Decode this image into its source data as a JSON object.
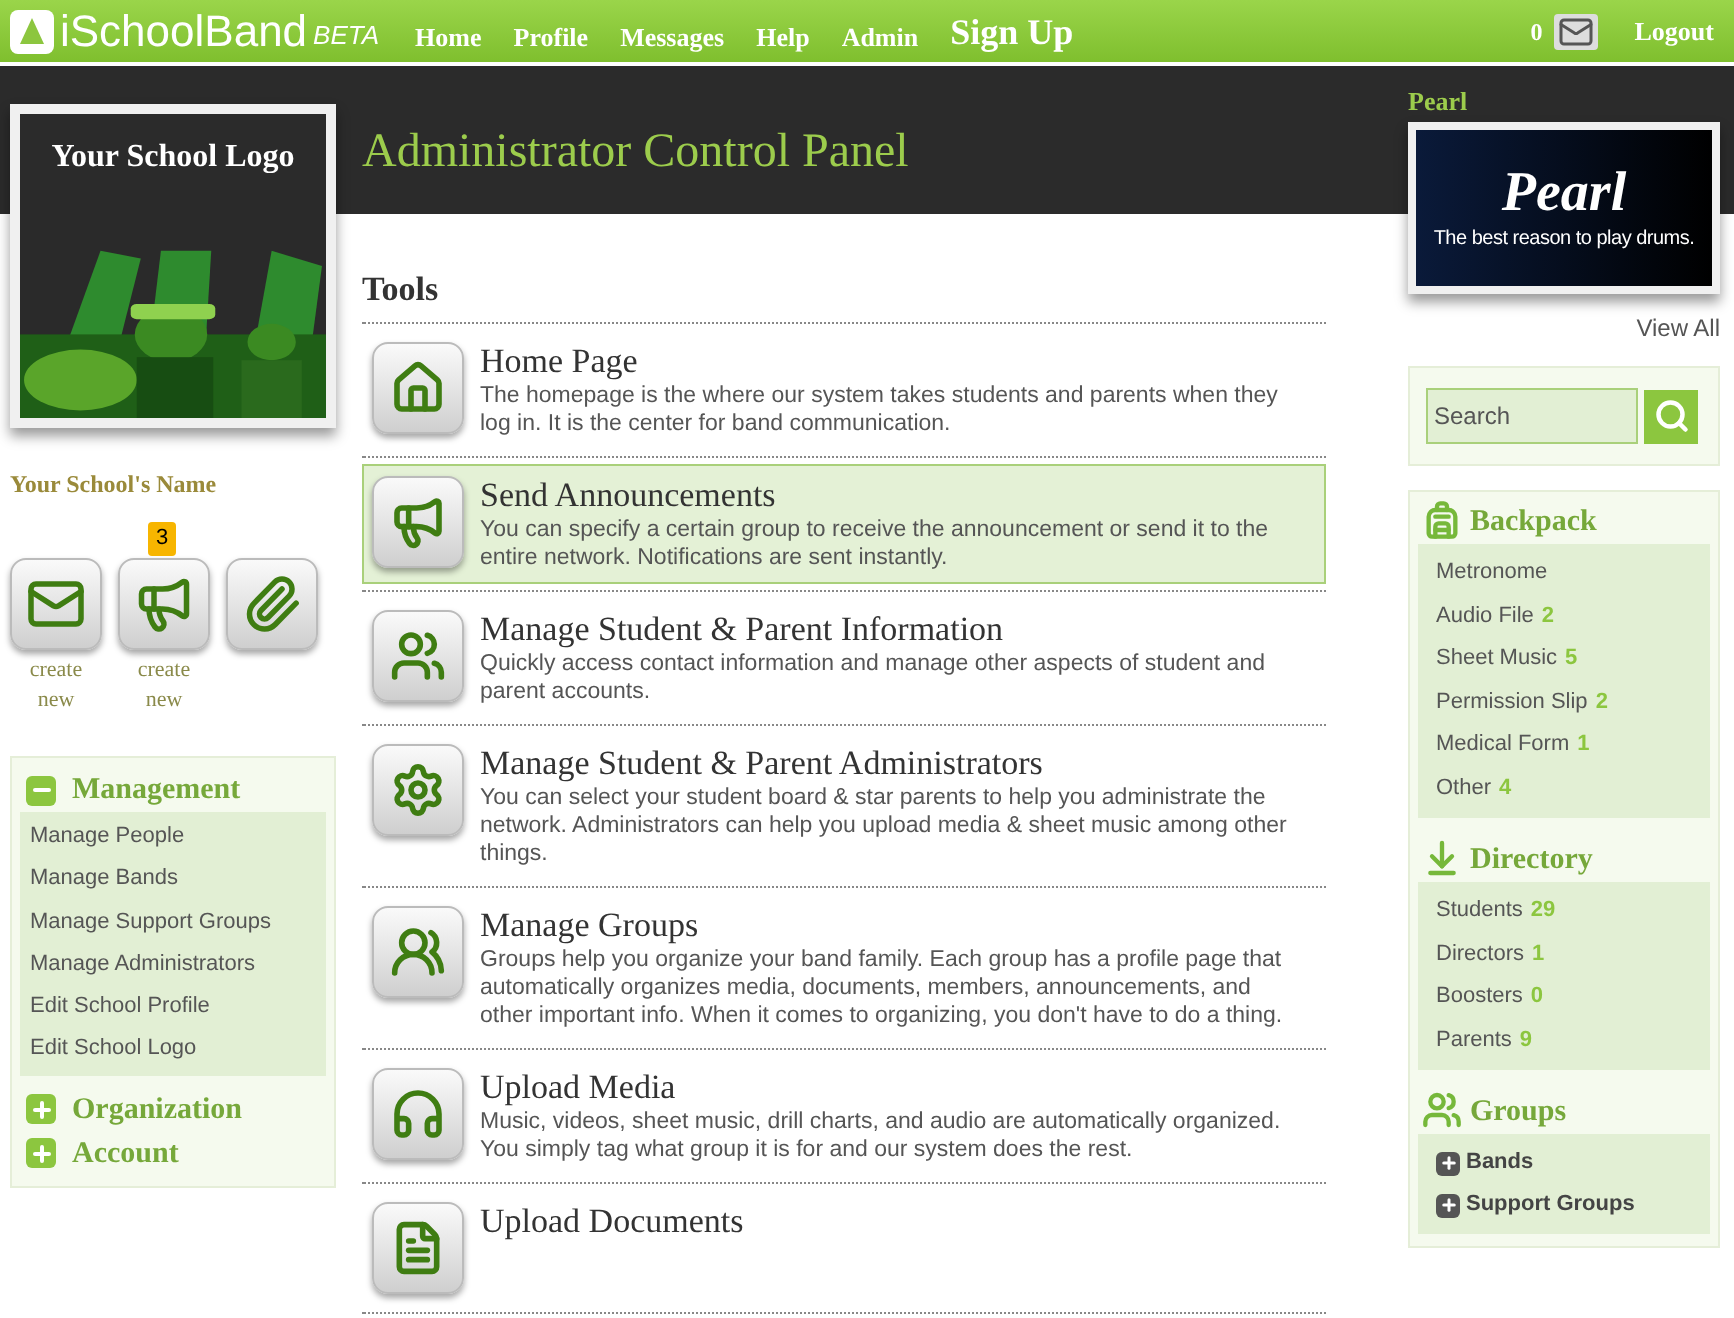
{
  "header": {
    "brand": "iSchoolBand",
    "beta": "BETA",
    "nav": [
      {
        "label": "Home",
        "kind": "link"
      },
      {
        "label": "Profile",
        "kind": "link"
      },
      {
        "label": "Messages",
        "kind": "link"
      },
      {
        "label": "Help",
        "kind": "link"
      },
      {
        "label": "Admin",
        "kind": "link"
      },
      {
        "label": "Sign Up",
        "kind": "signup"
      }
    ],
    "message_count": "0",
    "logout": "Logout"
  },
  "left": {
    "logo_text": "Your School Logo",
    "school_name": "Your School's Name",
    "quick_actions": [
      {
        "kind": "message",
        "caption": "create new"
      },
      {
        "kind": "announcement",
        "caption": "create new",
        "badge": "3"
      },
      {
        "kind": "attachment"
      }
    ],
    "sections": [
      {
        "title": "Management",
        "expanded": true,
        "items": [
          "Manage People",
          "Manage Bands",
          "Manage Support Groups",
          "Manage Administrators",
          "Edit School Profile",
          "Edit School Logo"
        ]
      },
      {
        "title": "Organization",
        "expanded": false
      },
      {
        "title": "Account",
        "expanded": false
      }
    ]
  },
  "main": {
    "title": "Administrator Control Panel",
    "section": "Tools",
    "tools": [
      {
        "title": "Home Page",
        "description": "The homepage is the where our system takes students and parents when they log in. It is the center for band communication.",
        "selected": false
      },
      {
        "title": "Send Announcements",
        "description": "You can specify a certain group to receive the announcement or send it to the entire network. Notifications are sent instantly.",
        "selected": true
      },
      {
        "title": "Manage Student & Parent Information",
        "description": "Quickly access contact information and manage other aspects of student and parent accounts.",
        "selected": false
      },
      {
        "title": "Manage Student & Parent Administrators",
        "description": "You can select your student board & star parents to help you administrate the network. Administrators can help you upload media & sheet music among other things.",
        "selected": false
      },
      {
        "title": "Manage Groups",
        "description": "Groups help you organize your band family. Each group has a profile page that automatically organizes media, documents, members, announcements, and other important info. When it comes to organizing, you don't have to do a thing.",
        "selected": false
      },
      {
        "title": "Upload Media",
        "description": "Music, videos, sheet music, drill charts, and audio are automatically organized. You simply tag what group it is for and our system does the rest.",
        "selected": false
      },
      {
        "title": "Upload Documents",
        "selected": false
      }
    ]
  },
  "right": {
    "sponsor": "Pearl",
    "ad": {
      "logo": "Pearl",
      "tagline": "The best reason to play drums."
    },
    "view_all": "View All",
    "search": {
      "placeholder": "Search"
    },
    "backpack": {
      "title": "Backpack",
      "items": [
        {
          "label": "Metronome"
        },
        {
          "label": "Audio File",
          "count": "2"
        },
        {
          "label": "Sheet Music",
          "count": "5"
        },
        {
          "label": "Permission Slip",
          "count": "2"
        },
        {
          "label": "Medical Form",
          "count": "1"
        },
        {
          "label": "Other",
          "count": "4"
        }
      ]
    },
    "directory": {
      "title": "Directory",
      "items": [
        {
          "label": "Students",
          "count": "29"
        },
        {
          "label": "Directors",
          "count": "1"
        },
        {
          "label": "Boosters",
          "count": "0"
        },
        {
          "label": "Parents",
          "count": "9"
        }
      ]
    },
    "groups": {
      "title": "Groups",
      "items": [
        {
          "label": "Bands",
          "expanded": false
        },
        {
          "label": "Support Groups",
          "expanded": false
        }
      ]
    }
  }
}
